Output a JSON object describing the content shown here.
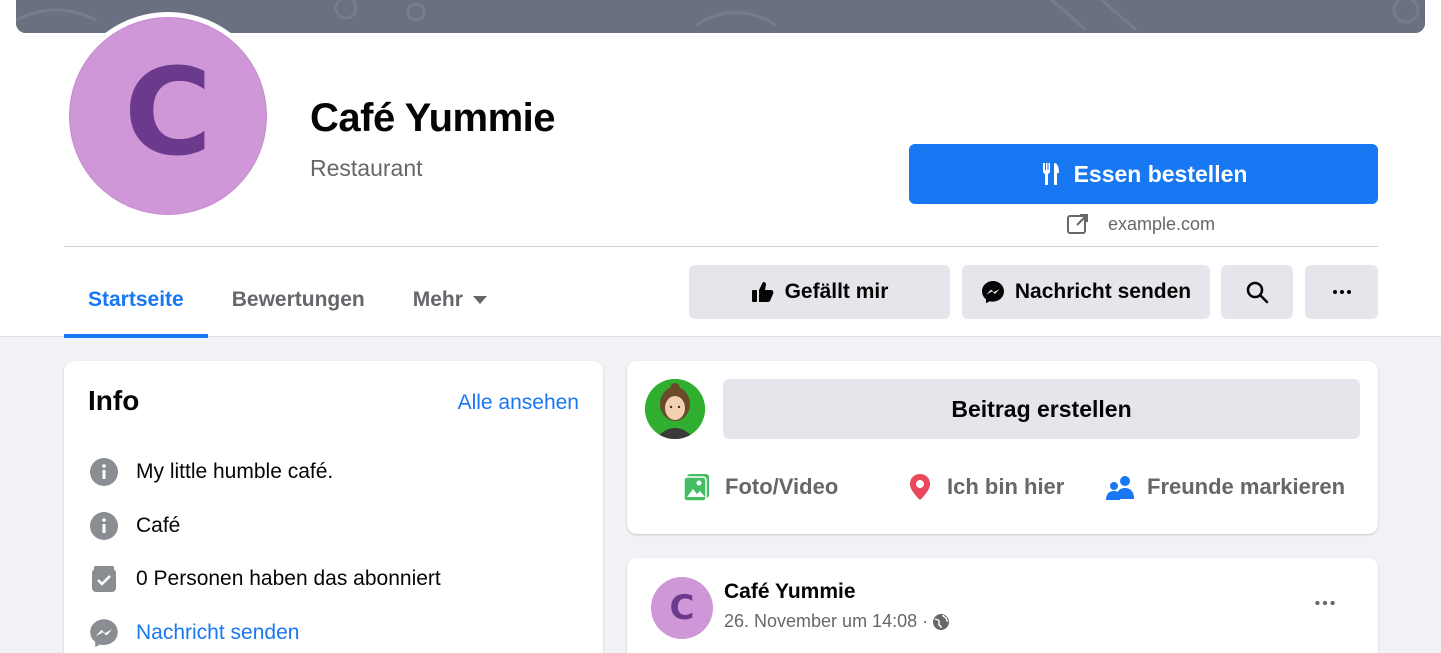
{
  "page": {
    "avatar_letter": "C",
    "title": "Café Yummie",
    "category": "Restaurant",
    "order_button": "Essen bestellen",
    "website": "example.com"
  },
  "tabs": [
    "Startseite",
    "Bewertungen",
    "Mehr"
  ],
  "actions": {
    "like": "Gefällt mir",
    "message": "Nachricht senden"
  },
  "info": {
    "title": "Info",
    "see_all": "Alle ansehen",
    "rows": [
      {
        "icon": "info-icon",
        "text": "My little humble café."
      },
      {
        "icon": "info-icon",
        "text": "Café"
      },
      {
        "icon": "check-box-icon",
        "text": "0 Personen haben das abonniert"
      },
      {
        "icon": "messenger-icon",
        "text": "Nachricht senden"
      }
    ]
  },
  "composer": {
    "placeholder": "Beitrag erstellen",
    "photo": "Foto/Video",
    "checkin": "Ich bin hier",
    "tag": "Freunde markieren"
  },
  "post": {
    "avatar_letter": "C",
    "author": "Café Yummie",
    "timestamp": "26. November um 14:08 ·"
  },
  "colors": {
    "accent": "#1877f2",
    "avatar_bg": "#cf96d8",
    "avatar_letter": "#6b3a8c"
  }
}
